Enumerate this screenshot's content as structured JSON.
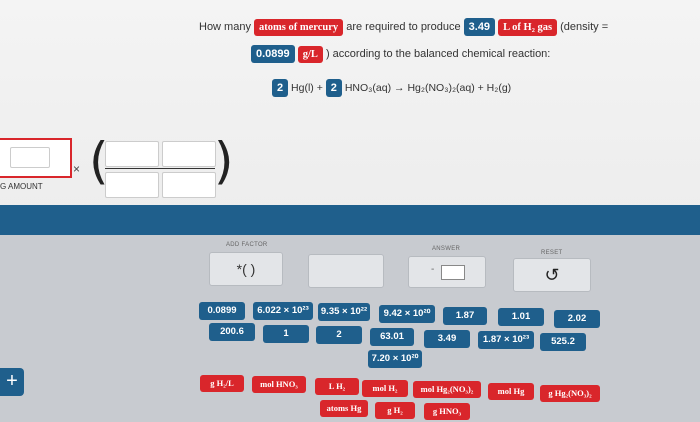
{
  "question": {
    "prefix": "How many",
    "target_unit": "atoms of mercury",
    "mid": "are required to produce",
    "given_value": "3.49",
    "given_unit": "L of H₂ gas",
    "density_label": "(density =",
    "density_value": "0.0899",
    "density_unit": "g/L",
    "suffix": ") according to the balanced chemical reaction:"
  },
  "reaction": {
    "coef1": "2",
    "species1": "Hg(l) +",
    "coef2": "2",
    "species2": "HNO₃(aq) → Hg₂(NO₃)₂(aq) + H₂(g)"
  },
  "setup": {
    "amount_label": "G AMOUNT",
    "times": "×"
  },
  "controls": {
    "add_factor_label": "ADD FACTOR",
    "add_factor_value": "*( )",
    "answer_label": "ANSWER",
    "reset_label": "RESET",
    "reset_icon": "↺",
    "answer_field": "-"
  },
  "value_buttons_row1": [
    "0.0899",
    "6.022 × 10²³",
    "9.35 × 10²²",
    "9.42 × 10²⁰",
    "1.87",
    "1.01",
    "2.02"
  ],
  "value_buttons_row2": [
    "200.6",
    "1",
    "2",
    "63.01",
    "3.49",
    "1.87 × 10²³",
    "525.2"
  ],
  "value_buttons_row3": [
    "7.20 × 10²⁰"
  ],
  "unit_buttons_row1": [
    "g H₂/L",
    "mol HNO₃",
    "L H₂",
    "mol H₂",
    "mol Hg₂(NO₃)₂",
    "mol Hg",
    "g Hg₂(NO₃)₂"
  ],
  "unit_buttons_row2": [
    "atoms Hg",
    "g H₂",
    "g HNO₃"
  ],
  "plus_icon": "+"
}
